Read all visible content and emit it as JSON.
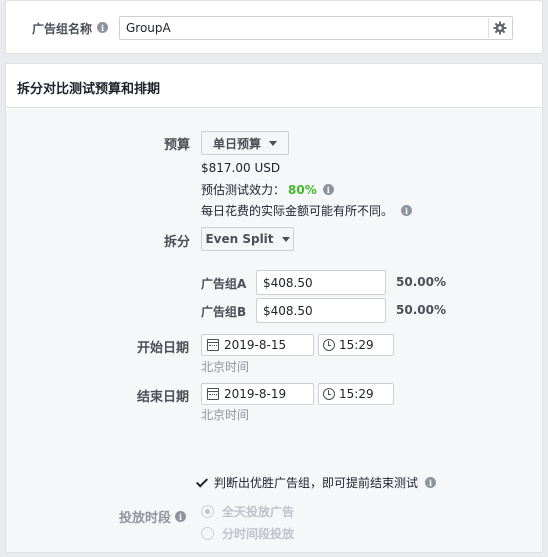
{
  "ad_set_name": {
    "label": "广告组名称",
    "value": "GroupA"
  },
  "section_title": "拆分对比测试预算和排期",
  "budget": {
    "label": "预算",
    "type_button": "单日预算",
    "amount": "$817.00 USD",
    "power_label": "预估测试效力：",
    "power_value": "80%",
    "note": "每日花费的实际金额可能有所不同。"
  },
  "split": {
    "label": "拆分",
    "button": "Even Split",
    "groups": [
      {
        "label": "广告组A",
        "value": "$408.50",
        "percent": "50.00%"
      },
      {
        "label": "广告组B",
        "value": "$408.50",
        "percent": "50.00%"
      }
    ]
  },
  "start": {
    "label": "开始日期",
    "date": "2019-8-15",
    "time": "15:29",
    "timezone": "北京时间"
  },
  "end": {
    "label": "结束日期",
    "date": "2019-8-19",
    "time": "15:29",
    "timezone": "北京时间"
  },
  "early_end": {
    "checked": true,
    "label": "判断出优胜广告组，即可提前结束测试"
  },
  "schedule": {
    "label": "投放时段",
    "options": [
      {
        "label": "全天投放广告",
        "selected": true
      },
      {
        "label": "分时间段投放",
        "selected": false
      }
    ]
  },
  "colors": {
    "accent_green": "#42b72a",
    "border": "#dddfe2",
    "muted": "#90949c"
  },
  "icons": [
    "info-icon",
    "gear-icon",
    "chevron-down-icon",
    "calendar-icon",
    "clock-icon",
    "checkmark-icon"
  ]
}
